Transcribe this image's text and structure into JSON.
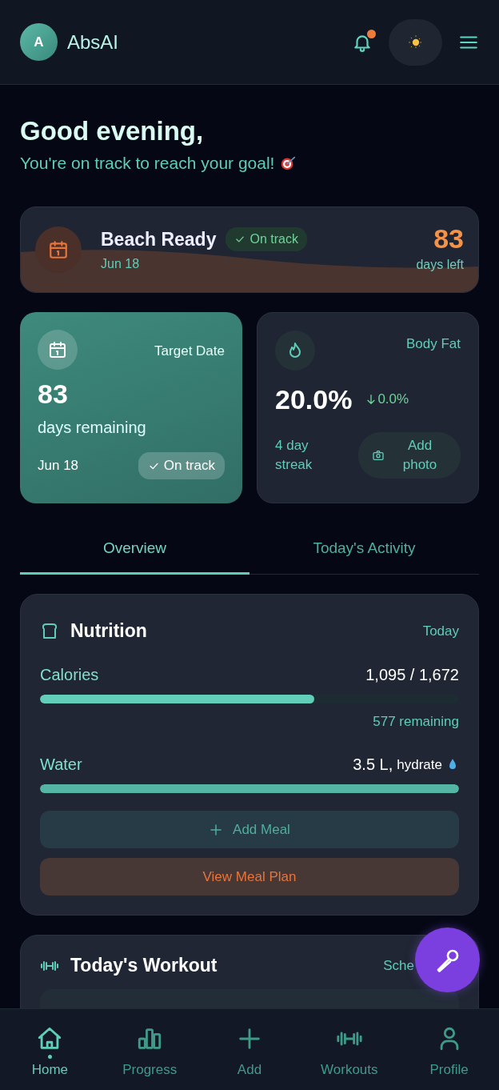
{
  "header": {
    "avatar": "A",
    "brand": "AbsAI",
    "notifications_unread": true
  },
  "greeting": {
    "title": "Good evening,",
    "subtitle": "You're on track to reach your goal!"
  },
  "goal": {
    "title": "Beach Ready",
    "badge": "On track",
    "date": "Jun 18",
    "days": "83",
    "days_label": "days left"
  },
  "target_card": {
    "label": "Target Date",
    "value": "83",
    "unit": "days remaining",
    "date": "Jun 18",
    "badge": "On track"
  },
  "body_fat_card": {
    "label": "Body Fat",
    "value": "20.0%",
    "change": "0.0%",
    "streak": "4 day streak",
    "button": "Add photo"
  },
  "tabs": [
    {
      "label": "Overview",
      "selected": true
    },
    {
      "label": "Today's Activity",
      "selected": false
    }
  ],
  "nutrition": {
    "title": "Nutrition",
    "period": "Today",
    "metrics": [
      {
        "label": "Calories",
        "value": "1,095 / 1,672",
        "level": 0.655,
        "remaining": "577 remaining"
      },
      {
        "label": "Water",
        "value": "3.5 L,",
        "note": "hydrate",
        "level": 1.0
      }
    ],
    "add_button": "Add Meal",
    "plan_button": "View Meal Plan"
  },
  "workout": {
    "title": "Today's Workout",
    "link": "Sche"
  },
  "nav": [
    {
      "label": "Home",
      "selected": true
    },
    {
      "label": "Progress",
      "selected": false
    },
    {
      "label": "Add",
      "selected": false
    },
    {
      "label": "Workouts",
      "selected": false
    },
    {
      "label": "Profile",
      "selected": false
    }
  ]
}
